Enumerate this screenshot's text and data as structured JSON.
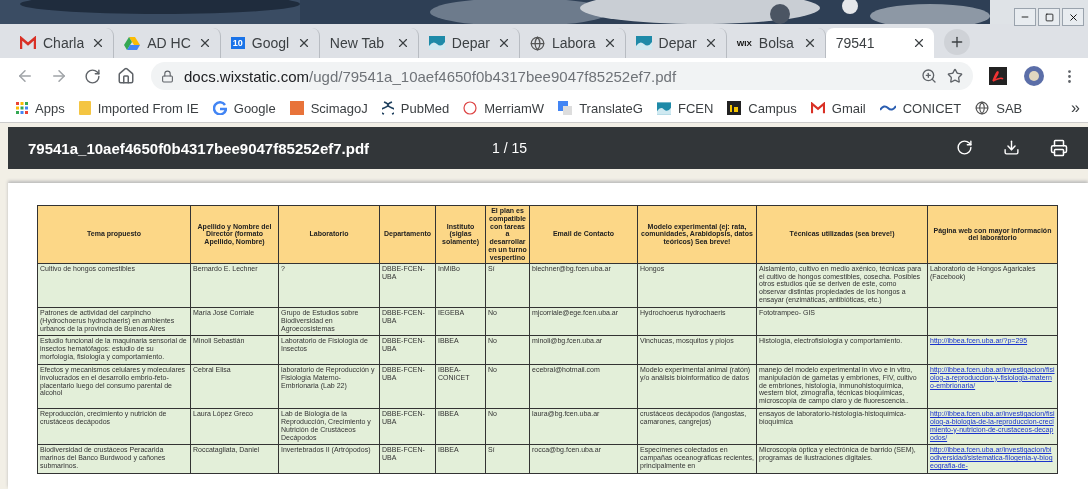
{
  "tabs": [
    {
      "label": "Charla",
      "kind": "gmail",
      "selected": false
    },
    {
      "label": "AD HC",
      "kind": "drive",
      "selected": false
    },
    {
      "label": "Googl",
      "kind": "calendar",
      "icon_text": "10",
      "selected": false
    },
    {
      "label": "New Tab",
      "kind": "plain",
      "selected": false
    },
    {
      "label": "Depar",
      "kind": "wave",
      "selected": false
    },
    {
      "label": "Labora",
      "kind": "globe",
      "selected": false
    },
    {
      "label": "Depar",
      "kind": "wave",
      "selected": false
    },
    {
      "label": "Bolsa",
      "kind": "wix",
      "icon_text": "WIX",
      "selected": false
    },
    {
      "label": "79541",
      "kind": "plain",
      "selected": true
    }
  ],
  "address": {
    "host": "docs.wixstatic.com",
    "path": "/ugd/79541a_10aef4650f0b4317bee9047f85252ef7.pdf"
  },
  "bookmarks": [
    {
      "label": "Apps",
      "kind": "apps"
    },
    {
      "label": "Imported From IE",
      "kind": "folder"
    },
    {
      "label": "Google",
      "kind": "google"
    },
    {
      "label": "ScimagoJ",
      "kind": "journal"
    },
    {
      "label": "PubMed",
      "kind": "pubmed"
    },
    {
      "label": "MerriamW",
      "kind": "ring"
    },
    {
      "label": "TranslateG",
      "kind": "translate"
    },
    {
      "label": "FCEN",
      "kind": "wave"
    },
    {
      "label": "Campus",
      "kind": "campus"
    },
    {
      "label": "Gmail",
      "kind": "gmail"
    },
    {
      "label": "CONICET",
      "kind": "swoosh"
    },
    {
      "label": "SAB",
      "kind": "globe"
    }
  ],
  "bookmarks_more": "»",
  "pdf": {
    "filename": "79541a_10aef4650f0b4317bee9047f85252ef7.pdf",
    "page": "1 / 15"
  },
  "table": {
    "columns": [
      "Tema propuesto",
      "Apellido y Nombre del Director (formato Apellido, Nombre)",
      "Laboratorio",
      "Departamento",
      "Instituto (siglas solamente)",
      "El plan es compatible con tareas a desarrollar en un turno vespertino",
      "Email de Contacto",
      "Modelo experimental (ej: rata, comunidades, Arabidopsis, datos teóricos) Sea breve!",
      "Técnicas utilizadas (sea breve!)",
      "Página web con mayor información del laboratorio"
    ],
    "rows": [
      {
        "cells": [
          "Cultivo de hongos comestibles",
          "Bernardo E. Lechner",
          "?",
          "DBBE-FCEN-UBA",
          "InMiBo",
          "Sí",
          "blechner@bg.fcen.uba.ar",
          "Hongos",
          "Aislamiento, cultivo en medio axénico, técnicas para el cultivo de hongos comestibles, cosecha. Posibles otros estudios que se deriven de este, como observar distintas propiedades de los hongos a ensayar (enzimáticas, antibióticas, etc.)"
        ],
        "web": {
          "text": "Laboratorio de Hongos Agaricales (Facebook)",
          "link": false
        }
      },
      {
        "cells": [
          "Patrones de actividad del carpincho (Hydrochoerus hydrochaeris) en ambientes urbanos de la provincia de Buenos Aires",
          "María José Corriale",
          "Grupo de Estudios sobre Biodiversidad en Agroecosistemas",
          "DBBE-FCEN-UBA",
          "IEGEBA",
          "No",
          "mjcorriale@ege.fcen.uba.ar",
          "Hydrochoerus hydrochaeris",
          "Fototrampeo- GIS"
        ]
      },
      {
        "cells": [
          "Estudio funcional de la maquinaria sensorial de insectos hematófagos: estudio de su morfología, fisiología y comportamiento.",
          "Minoli Sebastián",
          "Laboratorio de Fisiología de Insectos",
          "DBBE-FCEN-UBA",
          "IBBEA",
          "No",
          "minoli@bg.fcen.uba.ar",
          "Vinchucas, mosquitos y piojos",
          "Histología, electrofisiología y comportamiento."
        ],
        "web": {
          "text": "http://ibbea.fcen.uba.ar/?p=295",
          "link": true
        }
      },
      {
        "cells": [
          "Efectos y mecanismos celulares y moleculares involucrados en el desarrollo embrio-feto-placentario luego del consumo parental de alcohol",
          "Cebral Elisa",
          "laboratorio de Reproducción y Fisiología Materno-Embrionaria (Lab 22)",
          "DBBE-FCEN-UBA",
          "IBBEA-CONICET",
          "No",
          "ecebral@hotmail.com",
          "Modelo experimental animal (ratón) y/o análisis bioinformático de datos",
          "manejo del modelo experimental in vivo e in vitro, manipulación de gametas y embriones, FIV, cultivo de embriones, histología, inmunohistoquímica, western blot, zimografía, técnicas bioquímicas, microscopía de campo claro y de fluorescencia.."
        ],
        "web": {
          "text": "http://ibbea.fcen.uba.ar/investigacion/fisiolog-a-reproduccion-y-fisiologia-materno-embrionaria/",
          "link": true
        }
      },
      {
        "cells": [
          "Reproducción, crecimiento y nutrición de crustáceos decápodos",
          "Laura López Greco",
          "Lab de Biología de la Reproducción, Crecimiento y Nutrición de Crustáceos Decápodos",
          "DBBE-FCEN-UBA",
          "IBBEA",
          "No",
          "laura@bg.fcen.uba.ar",
          "crustáceos decápodos (langostas, camarones, cangrejos)",
          "ensayos de laboratorio-histología-histoquímica-bioquímica"
        ],
        "web": {
          "text": "http://ibbea.fcen.uba.ar/investigacion/fisiolog-a-biologia-de-la-reproduccion-crecimiento-y-nutricion-de-crustaceos-decapodos/",
          "link": true
        }
      },
      {
        "cells": [
          "Biodiversidad de crustáceos Peracarida marinos del Banco Burdwood y cañones submarinos.",
          "Roccatagliata, Daniel",
          "Invertebrados II (Artrópodos)",
          "DBBE-FCEN-UBA",
          "IBBEA",
          "Sí",
          "rocca@bg.fcen.uba.ar",
          "Especímenes colectados en campañas oceanográficas recientes, principalmente en",
          "Microscopía óptica y electrónica de barrido (SEM), programas de ilustraciones digitales."
        ],
        "web": {
          "text": "http://ibbea.fcen.uba.ar/investigacion/biodiversidad/sistematica-filogenia-y-biogeografia-de-",
          "link": true
        }
      }
    ]
  }
}
